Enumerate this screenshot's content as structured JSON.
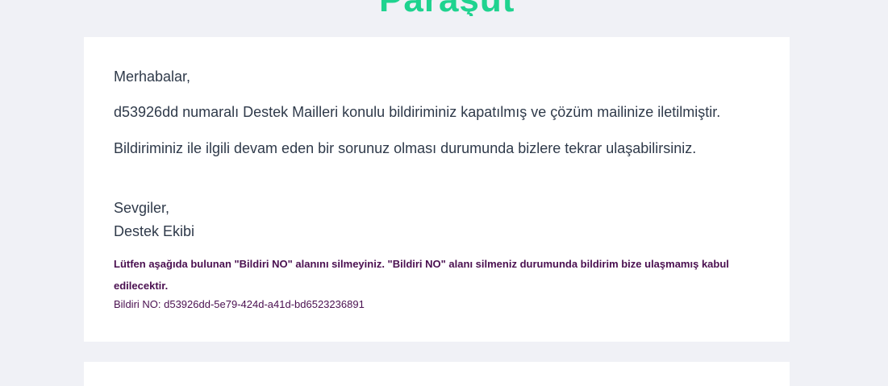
{
  "brand": {
    "logo_text": "Paraşüt",
    "accent_color": "#1fd38f"
  },
  "email": {
    "greeting": "Merhabalar,",
    "line1": "d53926dd numaralı Destek Mailleri konulu bildiriminiz kapatılmış ve çözüm mailinize iletilmiştir.",
    "line2": "Bildiriminiz ile ilgili devam eden bir sorunuz olması durumunda bizlere tekrar ulaşabilirsiniz.",
    "signoff": "Sevgiler,",
    "team": "Destek Ekibi",
    "notice": "Lütfen aşağıda bulunan \"Bildiri NO\" alanını silmeyiniz. \"Bildiri NO\" alanı silmeniz durumunda bildirim bize ulaşmamış kabul edilecektir.",
    "ticket_line": "Bildiri NO: d53926dd-5e79-424d-a41d-bd6523236891"
  }
}
